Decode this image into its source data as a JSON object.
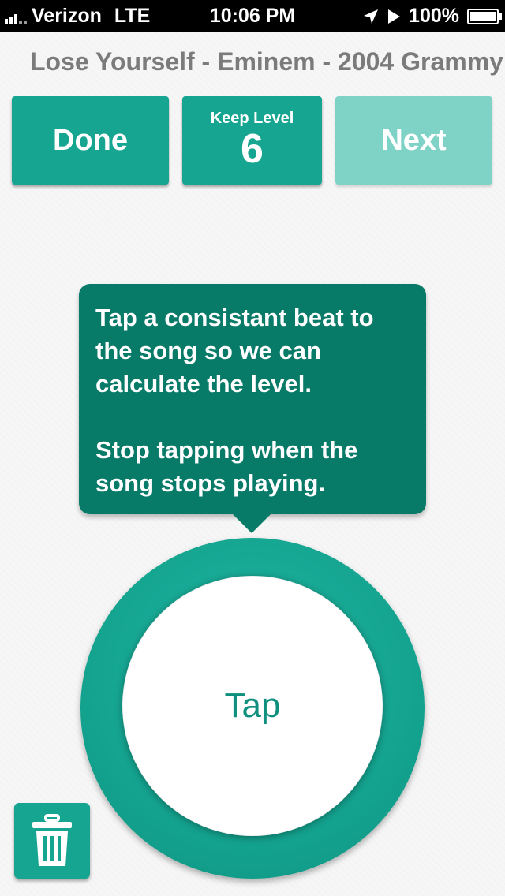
{
  "status": {
    "carrier": "Verizon",
    "network": "LTE",
    "time": "10:06 PM",
    "battery": "100%",
    "icons": [
      "signal-bars-icon",
      "location-arrow-icon",
      "play-icon",
      "battery-icon"
    ]
  },
  "song": {
    "title_line": "Lose Yourself  -  Eminem  -  2004 Grammy"
  },
  "toolbar": {
    "done_label": "Done",
    "keep_level_label": "Keep Level",
    "level_value": "6",
    "next_label": "Next"
  },
  "tooltip": {
    "line1": "Tap a consistant beat to the song so we can calculate the level.",
    "line2": "Stop tapping when the song stops playing."
  },
  "tap": {
    "label": "Tap"
  },
  "colors": {
    "accent": "#16a591",
    "accent_disabled": "#7fd3c6",
    "tooltip_bg": "#087a68",
    "title_gray": "#7b7b7b"
  }
}
